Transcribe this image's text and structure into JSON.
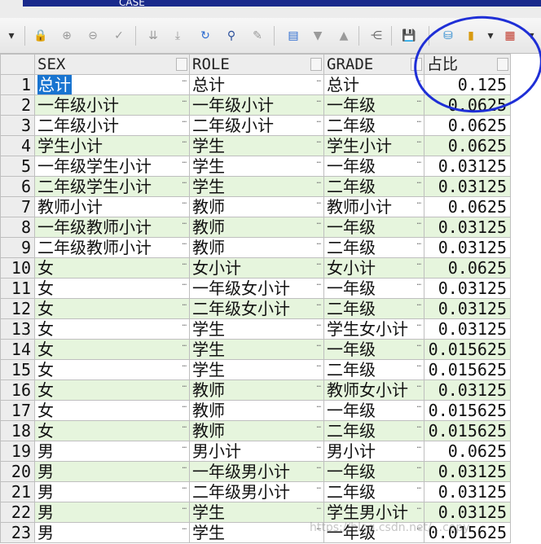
{
  "window": {
    "tab_title": "CASE"
  },
  "toolbar": {
    "buttons": [
      {
        "name": "dropdown-arrow-icon",
        "glyph": "▾",
        "color": "#333333"
      },
      {
        "name": "lock-icon",
        "glyph": "🔒",
        "color": "#c0392b"
      },
      {
        "name": "insert-record-icon",
        "glyph": "⊕",
        "color": "#9a9a9a"
      },
      {
        "name": "delete-record-icon",
        "glyph": "⊖",
        "color": "#9a9a9a"
      },
      {
        "name": "post-edit-checkmark-icon",
        "glyph": "✓",
        "color": "#9a9a9a"
      },
      {
        "name": "first-record-icon",
        "glyph": "⇊",
        "color": "#9a9a9a"
      },
      {
        "name": "last-record-icon",
        "glyph": "⤓",
        "color": "#9a9a9a"
      },
      {
        "name": "refresh-icon",
        "glyph": "↻",
        "color": "#2a6ad0"
      },
      {
        "name": "find-binoculars-icon",
        "glyph": "⚲",
        "color": "#2a4f9a"
      },
      {
        "name": "clear-eraser-icon",
        "glyph": "✎",
        "color": "#9a9a9a"
      },
      {
        "name": "single-record-view-icon",
        "glyph": "▤",
        "color": "#2a6ad0"
      },
      {
        "name": "move-down-icon",
        "glyph": "▼",
        "color": "#9a9a9a"
      },
      {
        "name": "move-up-icon",
        "glyph": "▲",
        "color": "#9a9a9a"
      },
      {
        "name": "query-tree-icon",
        "glyph": "⋲",
        "color": "#6a6a6a"
      },
      {
        "name": "save-floppy-icon",
        "glyph": "💾",
        "color": "#2a4f9a"
      },
      {
        "name": "export-database-icon",
        "glyph": "⛁",
        "color": "#2a8ad0"
      },
      {
        "name": "chart-bars-icon",
        "glyph": "▮",
        "color": "#d89a10"
      },
      {
        "name": "chart-dropdown-arrow-icon",
        "glyph": "▾",
        "color": "#333333"
      },
      {
        "name": "table-grid-icon",
        "glyph": "▦",
        "color": "#c0392b"
      },
      {
        "name": "table-dropdown-arrow-icon",
        "glyph": "▾",
        "color": "#333333"
      }
    ]
  },
  "grid": {
    "columns": [
      "SEX",
      "ROLE",
      "GRADE",
      "占比"
    ],
    "rows": [
      {
        "n": "1",
        "sex": "总计",
        "role": "总计",
        "grade": "总计",
        "ratio": "0.125"
      },
      {
        "n": "2",
        "sex": "一年级小计",
        "role": "一年级小计",
        "grade": "一年级",
        "ratio": "0.0625"
      },
      {
        "n": "3",
        "sex": "二年级小计",
        "role": "二年级小计",
        "grade": "二年级",
        "ratio": "0.0625"
      },
      {
        "n": "4",
        "sex": "学生小计",
        "role": "学生",
        "grade": "学生小计",
        "ratio": "0.0625"
      },
      {
        "n": "5",
        "sex": "一年级学生小计",
        "role": "学生",
        "grade": "一年级",
        "ratio": "0.03125"
      },
      {
        "n": "6",
        "sex": "二年级学生小计",
        "role": "学生",
        "grade": "二年级",
        "ratio": "0.03125"
      },
      {
        "n": "7",
        "sex": "教师小计",
        "role": "教师",
        "grade": "教师小计",
        "ratio": "0.0625"
      },
      {
        "n": "8",
        "sex": "一年级教师小计",
        "role": "教师",
        "grade": "一年级",
        "ratio": "0.03125"
      },
      {
        "n": "9",
        "sex": "二年级教师小计",
        "role": "教师",
        "grade": "二年级",
        "ratio": "0.03125"
      },
      {
        "n": "10",
        "sex": "女",
        "role": "女小计",
        "grade": "女小计",
        "ratio": "0.0625"
      },
      {
        "n": "11",
        "sex": "女",
        "role": "一年级女小计",
        "grade": "一年级",
        "ratio": "0.03125"
      },
      {
        "n": "12",
        "sex": "女",
        "role": "二年级女小计",
        "grade": "二年级",
        "ratio": "0.03125"
      },
      {
        "n": "13",
        "sex": "女",
        "role": "学生",
        "grade": "学生女小计",
        "ratio": "0.03125"
      },
      {
        "n": "14",
        "sex": "女",
        "role": "学生",
        "grade": "一年级",
        "ratio": "0.015625"
      },
      {
        "n": "15",
        "sex": "女",
        "role": "学生",
        "grade": "二年级",
        "ratio": "0.015625"
      },
      {
        "n": "16",
        "sex": "女",
        "role": "教师",
        "grade": "教师女小计",
        "ratio": "0.03125"
      },
      {
        "n": "17",
        "sex": "女",
        "role": "教师",
        "grade": "一年级",
        "ratio": "0.015625"
      },
      {
        "n": "18",
        "sex": "女",
        "role": "教师",
        "grade": "二年级",
        "ratio": "0.015625"
      },
      {
        "n": "19",
        "sex": "男",
        "role": "男小计",
        "grade": "男小计",
        "ratio": "0.0625"
      },
      {
        "n": "20",
        "sex": "男",
        "role": "一年级男小计",
        "grade": "一年级",
        "ratio": "0.03125"
      },
      {
        "n": "21",
        "sex": "男",
        "role": "二年级男小计",
        "grade": "二年级",
        "ratio": "0.03125"
      },
      {
        "n": "22",
        "sex": "男",
        "role": "学生",
        "grade": "学生男小计",
        "ratio": "0.03125"
      },
      {
        "n": "23",
        "sex": "男",
        "role": "学生",
        "grade": "一年级",
        "ratio": "0.015625"
      }
    ]
  },
  "colors": {
    "alt_row": "#e6f5dd",
    "selection": "#1874d0",
    "annotation_circle": "#1f2fd6"
  },
  "watermark": "https://blog.csdn.net/...copy"
}
